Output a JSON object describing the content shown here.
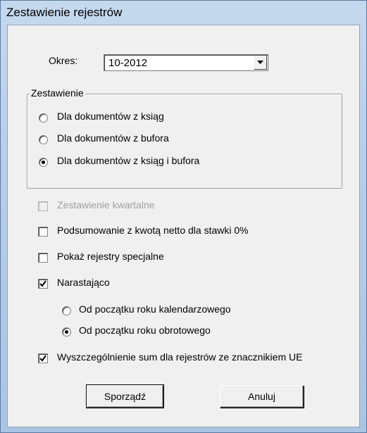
{
  "window": {
    "title": "Zestawienie rejestrów"
  },
  "period": {
    "label": "Okres:",
    "value": "10-2012"
  },
  "summary_group": {
    "title": "Zestawienie",
    "options": [
      {
        "label": "Dla dokumentów z ksiąg",
        "selected": false
      },
      {
        "label": "Dla dokumentów z bufora",
        "selected": false
      },
      {
        "label": "Dla dokumentów z ksiąg i bufora",
        "selected": true
      }
    ]
  },
  "checkboxes": {
    "quarterly": {
      "label": "Zestawienie kwartalne",
      "checked": false,
      "enabled": false
    },
    "net_zero": {
      "label": "Podsumowanie z kwotą netto dla stawki 0%",
      "checked": false,
      "enabled": true
    },
    "special": {
      "label": "Pokaż rejestry specjalne",
      "checked": false,
      "enabled": true
    },
    "cumulative": {
      "label": "Narastająco",
      "checked": true,
      "enabled": true
    },
    "eu_sums": {
      "label": "Wyszczególnienie sum dla rejestrów ze znacznikiem UE",
      "checked": true,
      "enabled": true
    }
  },
  "cumulative_options": [
    {
      "label": "Od początku roku kalendarzowego",
      "selected": false
    },
    {
      "label": "Od początku roku obrotowego",
      "selected": true
    }
  ],
  "buttons": {
    "ok": "Sporządź",
    "cancel": "Anuluj"
  }
}
